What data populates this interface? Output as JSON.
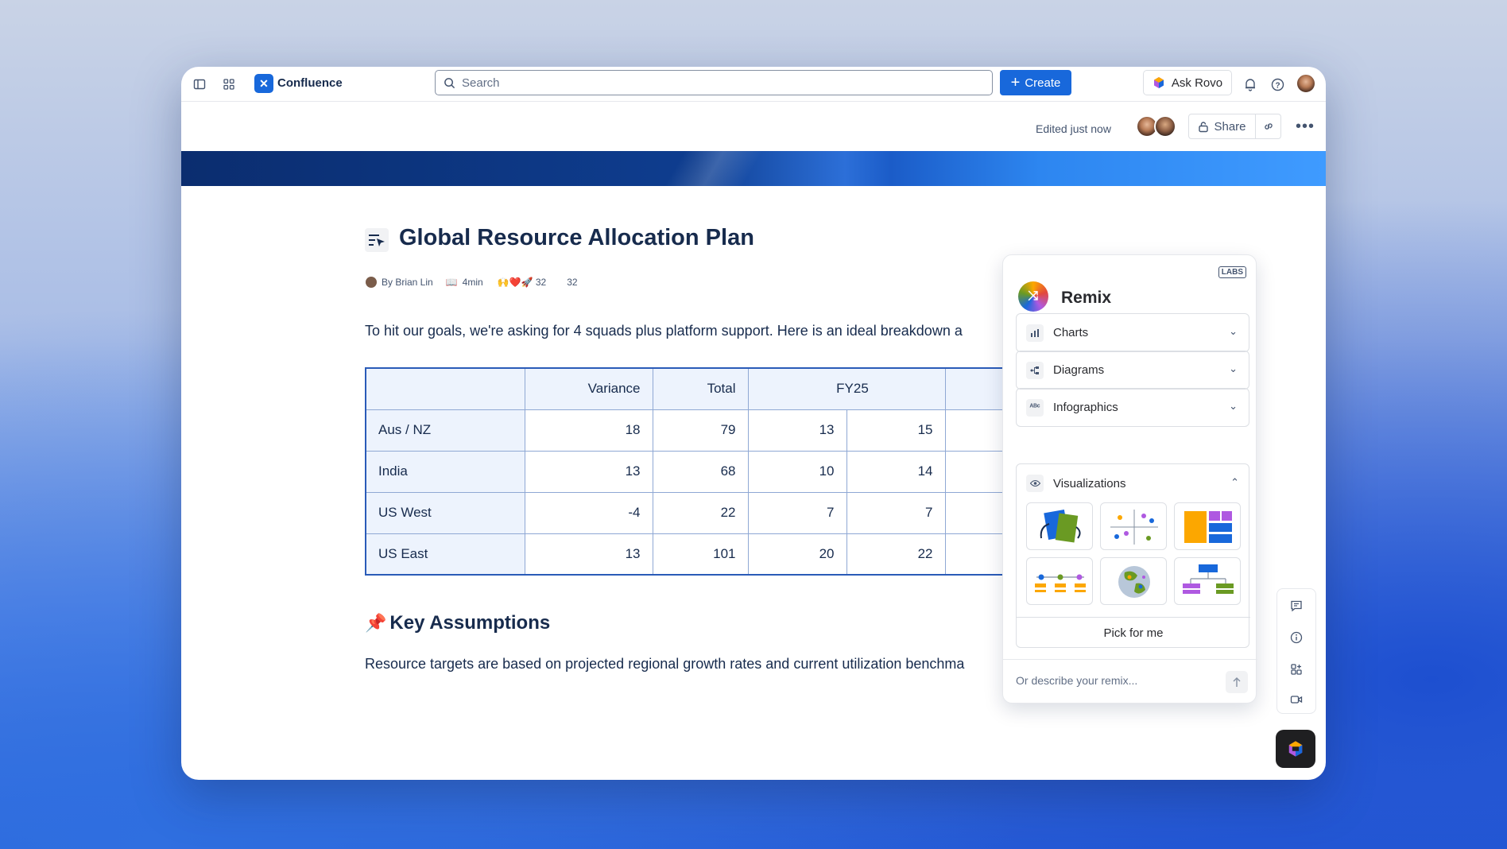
{
  "topbar": {
    "app_name": "Confluence",
    "search_placeholder": "Search",
    "create_label": "Create",
    "ask_rovo_label": "Ask Rovo"
  },
  "subbar": {
    "edited": "Edited just now",
    "share_label": "Share"
  },
  "page": {
    "title": "Global Resource Allocation Plan",
    "author": "By Brian Lin",
    "read_time": "4min",
    "reactions": "🙌❤️🚀 32",
    "reaction_count": "32",
    "intro": "To hit our goals, we're asking for 4 squads plus platform support. Here is an ideal breakdown a",
    "table": {
      "headers": [
        "",
        "Variance",
        "Total",
        "FY25",
        ""
      ],
      "rows": [
        {
          "region": "Aus / NZ",
          "variance": "18",
          "total": "79",
          "c1": "13",
          "c2": "15"
        },
        {
          "region": "India",
          "variance": "13",
          "total": "68",
          "c1": "10",
          "c2": "14"
        },
        {
          "region": "US West",
          "variance": "-4",
          "total": "22",
          "c1": "7",
          "c2": "7"
        },
        {
          "region": "US East",
          "variance": "13",
          "total": "101",
          "c1": "20",
          "c2": "22"
        }
      ]
    },
    "section_heading": "Key Assumptions",
    "section_text": "Resource targets are based on projected regional growth rates and current utilization benchma"
  },
  "remix": {
    "badge": "LABS",
    "title": "Remix",
    "sections": [
      "Charts",
      "Diagrams",
      "Infographics"
    ],
    "visualizations_label": "Visualizations",
    "pick_label": "Pick for me",
    "describe_placeholder": "Or describe your remix..."
  },
  "colors": {
    "brand": "#1868db",
    "table_border": "#2a5bb8",
    "table_header_bg": "#edf3fd"
  }
}
